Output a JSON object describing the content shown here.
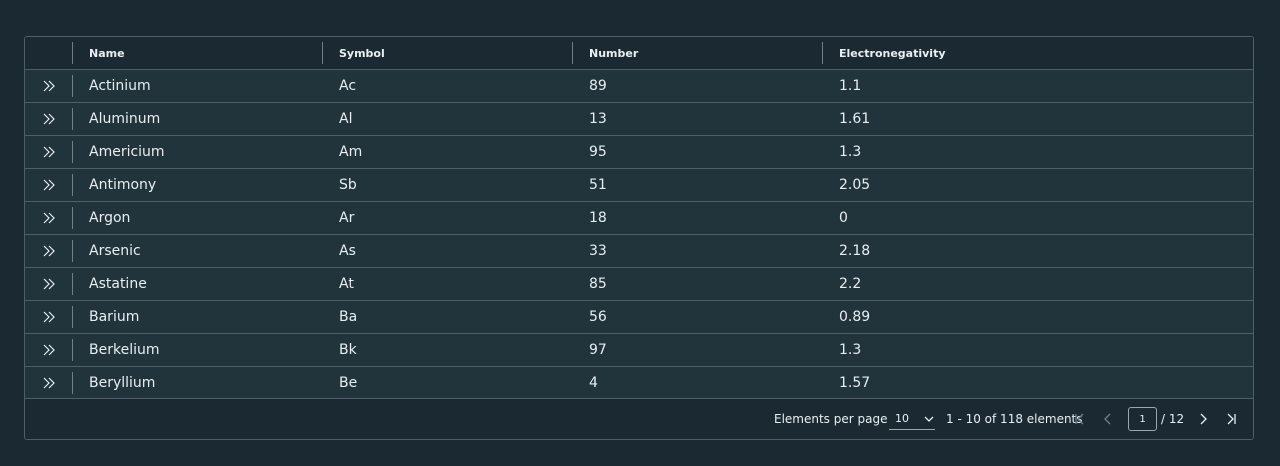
{
  "columns": {
    "name": "Name",
    "symbol": "Symbol",
    "number": "Number",
    "electronegativity": "Electronegativity"
  },
  "rows": [
    {
      "name": "Actinium",
      "symbol": "Ac",
      "number": "89",
      "electronegativity": "1.1"
    },
    {
      "name": "Aluminum",
      "symbol": "Al",
      "number": "13",
      "electronegativity": "1.61"
    },
    {
      "name": "Americium",
      "symbol": "Am",
      "number": "95",
      "electronegativity": "1.3"
    },
    {
      "name": "Antimony",
      "symbol": "Sb",
      "number": "51",
      "electronegativity": "2.05"
    },
    {
      "name": "Argon",
      "symbol": "Ar",
      "number": "18",
      "electronegativity": "0"
    },
    {
      "name": "Arsenic",
      "symbol": "As",
      "number": "33",
      "electronegativity": "2.18"
    },
    {
      "name": "Astatine",
      "symbol": "At",
      "number": "85",
      "electronegativity": "2.2"
    },
    {
      "name": "Barium",
      "symbol": "Ba",
      "number": "56",
      "electronegativity": "0.89"
    },
    {
      "name": "Berkelium",
      "symbol": "Bk",
      "number": "97",
      "electronegativity": "1.3"
    },
    {
      "name": "Beryllium",
      "symbol": "Be",
      "number": "4",
      "electronegativity": "1.57"
    }
  ],
  "row_expand_icon": "double-chevron-right-icon",
  "footer": {
    "per_page_label": "Elements per page",
    "per_page_value": "10",
    "range_text": "1 - 10 of 118 elements",
    "current_page": "1",
    "total_pages_text": "/ 12"
  },
  "colors": {
    "background": "#1b2a32",
    "row_background": "#21333b",
    "border": "#4e5f68",
    "text": "#e9eef0"
  }
}
